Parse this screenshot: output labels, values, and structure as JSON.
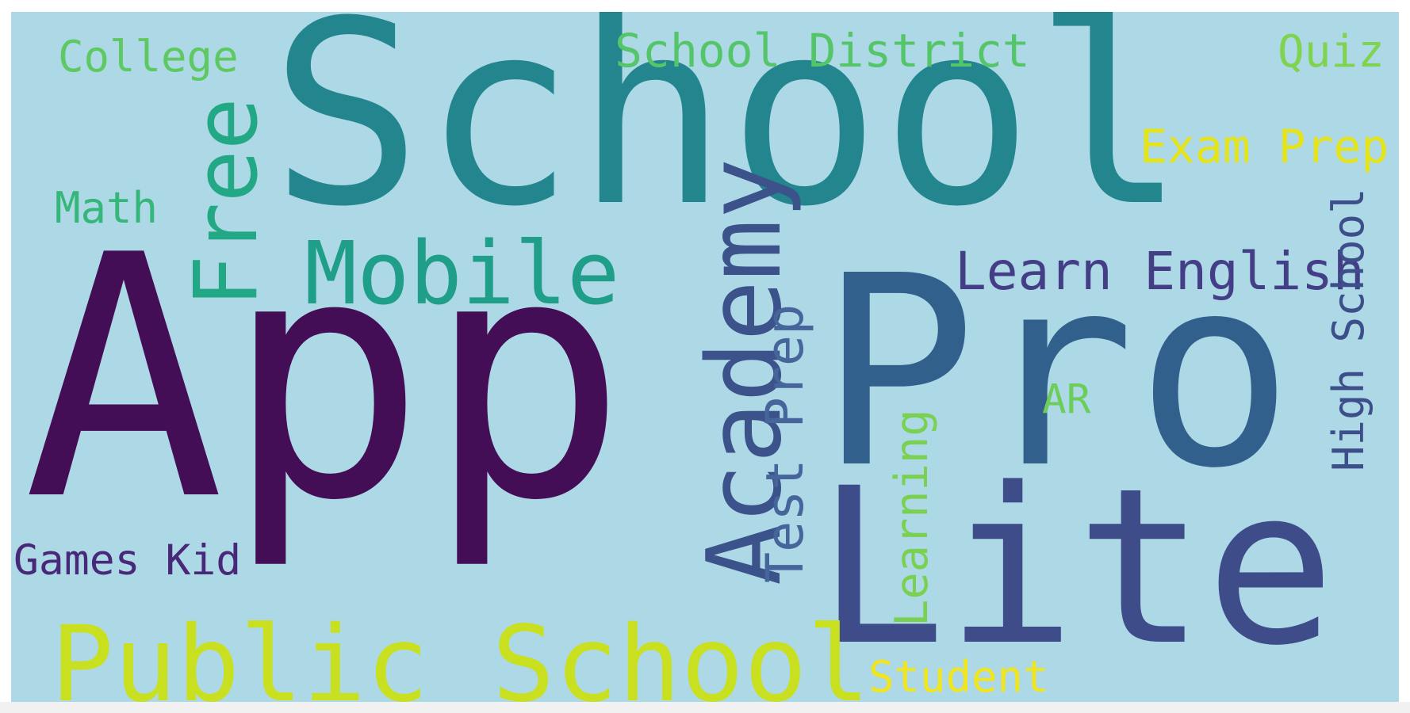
{
  "word_cloud": {
    "background_color": "#add8e6",
    "words": [
      {
        "id": "school",
        "text": "School",
        "color": "#23858d"
      },
      {
        "id": "app",
        "text": "App",
        "color": "#440e57"
      },
      {
        "id": "pro",
        "text": "Pro",
        "color": "#32608d"
      },
      {
        "id": "lite",
        "text": "Lite",
        "color": "#3e4c8a"
      },
      {
        "id": "public-school",
        "text": "Public School",
        "color": "#c8e020"
      },
      {
        "id": "mobile",
        "text": "Mobile",
        "color": "#1f9e89"
      },
      {
        "id": "free",
        "text": "Free",
        "color": "#22a884"
      },
      {
        "id": "academy",
        "text": "Academy",
        "color": "#3b528b"
      },
      {
        "id": "test-prep",
        "text": "Test Prep",
        "color": "#46659a"
      },
      {
        "id": "learn-english",
        "text": "Learn English",
        "color": "#433e85"
      },
      {
        "id": "high-school",
        "text": "High School",
        "color": "#3c4f8a"
      },
      {
        "id": "learning",
        "text": "Learning",
        "color": "#7ad151"
      },
      {
        "id": "ar",
        "text": "AR",
        "color": "#6ccd5a"
      },
      {
        "id": "student",
        "text": "Student",
        "color": "#f1e51d"
      },
      {
        "id": "exam-prep",
        "text": "Exam Prep",
        "color": "#e5e419"
      },
      {
        "id": "quiz",
        "text": "Quiz",
        "color": "#7fd34e"
      },
      {
        "id": "school-district",
        "text": "School District",
        "color": "#54c568"
      },
      {
        "id": "college",
        "text": "College",
        "color": "#5ec962"
      },
      {
        "id": "math",
        "text": "Math",
        "color": "#35b779"
      },
      {
        "id": "games-kid",
        "text": "Games Kid",
        "color": "#482878"
      }
    ]
  }
}
